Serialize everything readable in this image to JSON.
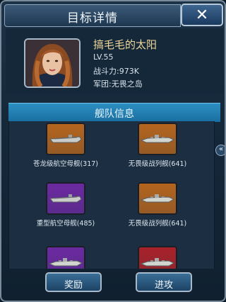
{
  "header": {
    "title": "目标详情",
    "close_label": "✕"
  },
  "player": {
    "name": "搞毛毛的太阳",
    "level": "LV.55",
    "power": "战斗力:973K",
    "legion": "军团:无畏之岛"
  },
  "fleet": {
    "title": "舰队信息",
    "ships": [
      {
        "label": "苍龙级航空母舰(317)",
        "bg": "#b4651e",
        "icon": "aircraft-carrier-icon"
      },
      {
        "label": "无畏级战列舰(641)",
        "bg": "#b4651e",
        "icon": "battleship-icon"
      },
      {
        "label": "重型航空母舰(485)",
        "bg": "#6b2aa0",
        "icon": "aircraft-carrier-icon"
      },
      {
        "label": "无畏级战列舰(641)",
        "bg": "#b4651e",
        "icon": "battleship-icon"
      },
      {
        "label": "",
        "bg": "#6b2aa0",
        "icon": "battleship-icon"
      },
      {
        "label": "",
        "bg": "#a8222a",
        "icon": "battleship-icon"
      }
    ]
  },
  "actions": {
    "reward_label": "奖励",
    "attack_label": "进攻"
  },
  "scroll_glyph": "«"
}
